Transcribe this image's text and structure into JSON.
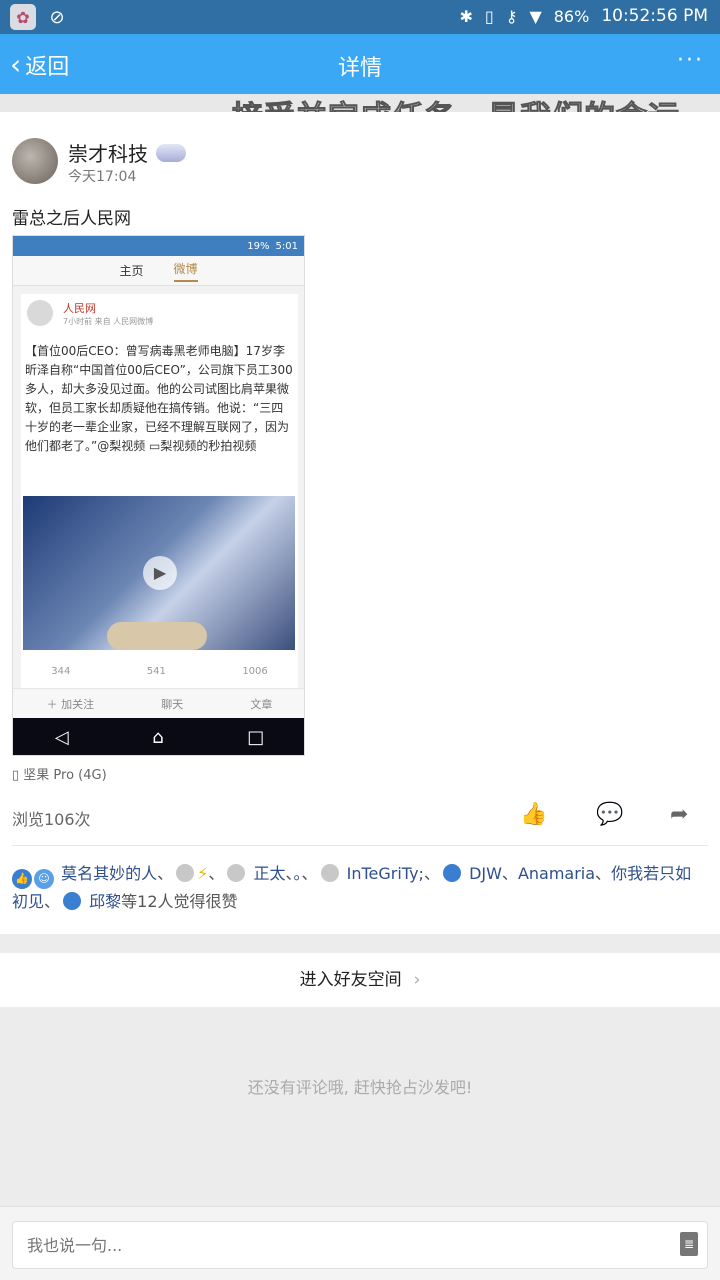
{
  "status_bar": {
    "battery": "86%",
    "time": "10:52:56 PM"
  },
  "nav": {
    "back_label": "返回",
    "title": "详情",
    "more": "···"
  },
  "banner_text": "接受并完成任务，是我们的命运。",
  "post": {
    "author": "崇才科技",
    "time": "今天17:04",
    "text": "雷总之后人民网",
    "device": "坚果 Pro (4G)",
    "views": "浏览106次",
    "screenshot": {
      "status_time": "5:01",
      "status_battery": "19%",
      "tabs": [
        "主页",
        "微博"
      ],
      "source_name": "人民网",
      "source_meta": "7小时前 来自 人民网微博",
      "body": "【首位00后CEO：曾写病毒黑老师电脑】17岁李昕泽自称“中国首位00后CEO”，公司旗下员工300多人，却大多没见过面。他的公司试图比肩苹果微软，但员工家长却质疑他在搞传销。他说：“三四十岁的老一辈企业家，已经不理解互联网了，因为他们都老了。”@梨视频 ▭梨视频的秒拍视频",
      "stats": [
        "344",
        "541",
        "1006"
      ],
      "actions": [
        "＋ 加关注",
        "聊天",
        "文章"
      ]
    }
  },
  "likes": {
    "names": [
      "莫名其妙的人",
      "正太",
      "。",
      "InTeGriTy;",
      "DJW",
      "Anamaria",
      "你我若只如初见",
      "邱黎"
    ],
    "suffix": "等12人觉得很赞"
  },
  "friend_space_label": "进入好友空间",
  "no_comment": "还没有评论哦, 赶快抢占沙发吧!",
  "comment_input": {
    "placeholder": "我也说一句..."
  }
}
